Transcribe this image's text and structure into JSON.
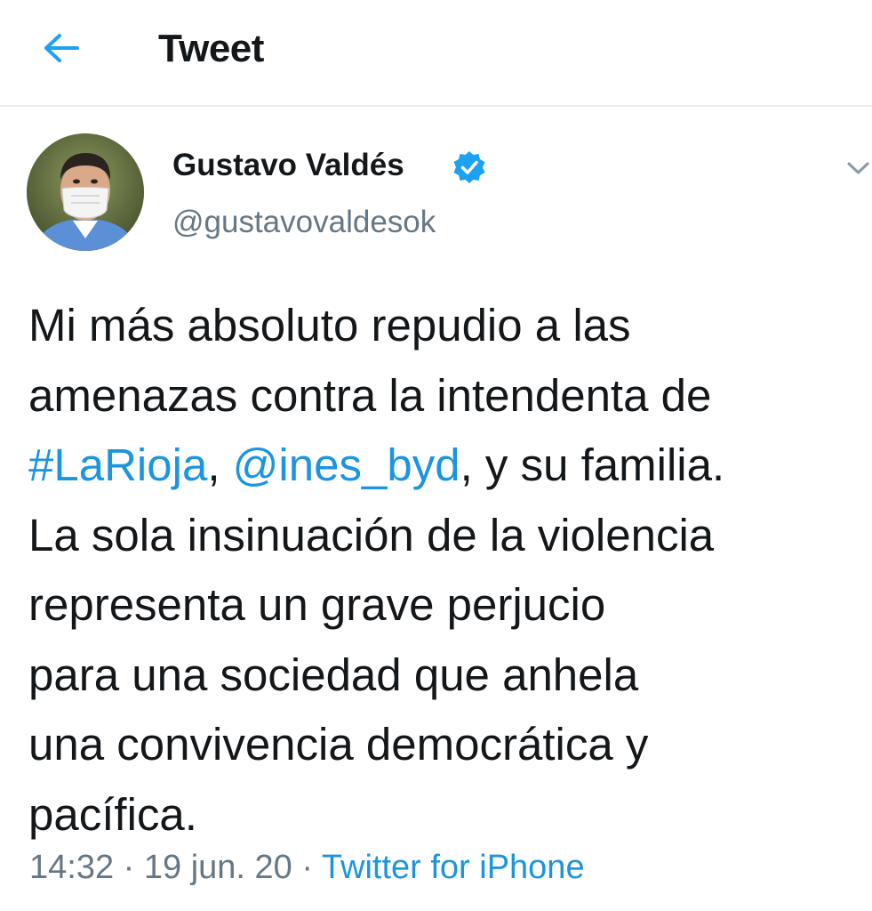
{
  "header": {
    "title": "Tweet",
    "back_icon": "arrow-left-icon",
    "accent": "#1da1f2"
  },
  "author": {
    "display_name": "Gustavo Valdés",
    "handle": "@gustavovaldesok",
    "verified": true,
    "verified_icon": "verified-badge-icon",
    "menu_icon": "chevron-down-icon"
  },
  "tweet": {
    "lines": {
      "l1": "Mi más absoluto repudio a las",
      "l2": "amenazas contra la intendenta de",
      "l3_hashtag": "#LaRioja",
      "l3_sep": ", ",
      "l3_mention": "@ines_byd",
      "l3_rest": ", y su familia.",
      "l4": "La sola insinuación de la violencia",
      "l5": "representa un grave perjucio",
      "l6": "para una sociedad que anhela",
      "l7": "una convivencia democrática y",
      "l8": "pacífica."
    }
  },
  "meta": {
    "time": "14:32",
    "separator": " · ",
    "date": "19 jun. 20",
    "source": "Twitter for iPhone"
  },
  "colors": {
    "text": "#14171a",
    "secondary": "#657786",
    "link": "#1b95e0",
    "divider": "#e6ecf0"
  }
}
